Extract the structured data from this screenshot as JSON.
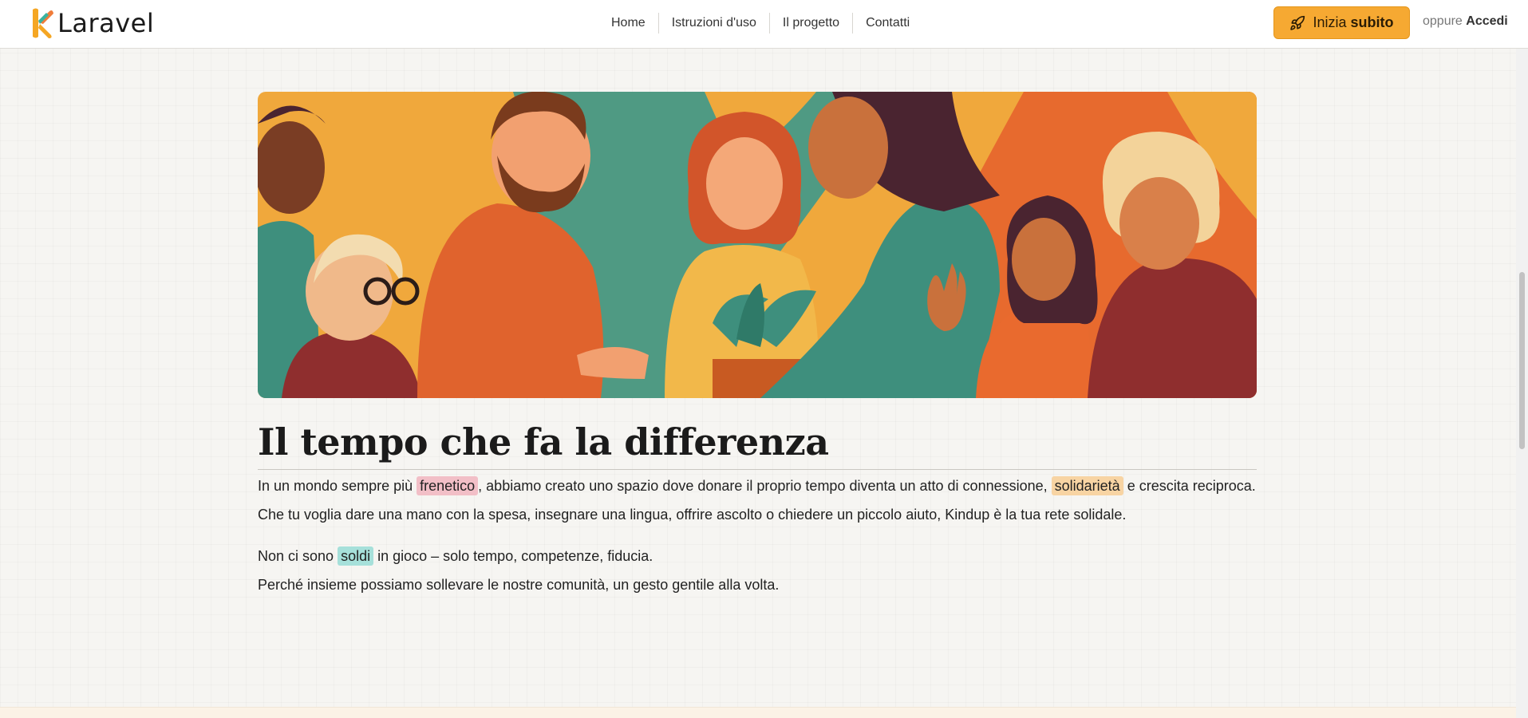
{
  "header": {
    "brand": "Laravel",
    "nav": [
      "Home",
      "Istruzioni d'uso",
      "Il progetto",
      "Contatti"
    ],
    "cta": {
      "prefix": "Inizia",
      "strong": "subito"
    },
    "login": {
      "prefix": "oppure",
      "link": "Accedi"
    }
  },
  "main": {
    "title": "Il tempo che fa la differenza",
    "p1": {
      "s1": "In un mondo sempre più ",
      "h1": "frenetico",
      "s2": ", abbiamo creato uno spazio dove donare il proprio tempo diventa un atto di connessione, ",
      "h2": "solidarietà",
      "s3": " e crescita reciproca.",
      "line2": "Che tu voglia dare una mano con la spesa, insegnare una lingua, offrire ascolto o chiedere un piccolo aiuto, Kindup è la tua rete solidale."
    },
    "p2": {
      "s1": "Non ci sono ",
      "h1": "soldi",
      "s2": " in gioco – solo tempo, competenze, fiducia.",
      "line2": "Perché insieme possiamo sollevare le nostre comunità, un gesto gentile alla volta."
    }
  },
  "colors": {
    "accent": "#f6a932",
    "highlight_pink": "#f2bfc7",
    "highlight_orange": "#f8d4a3",
    "highlight_teal": "#a6e0da"
  },
  "icons": [
    "laravel-logo-icon",
    "rocket-icon"
  ]
}
